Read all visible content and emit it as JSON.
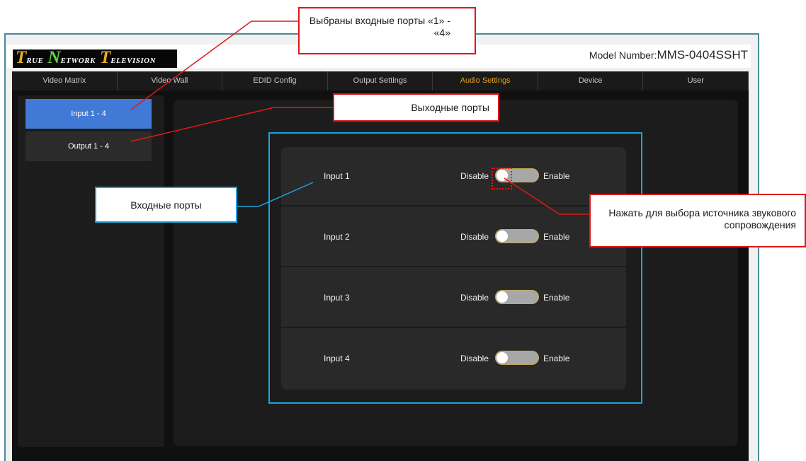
{
  "header": {
    "logo_parts": [
      "T",
      "RUE",
      "N",
      "ETWORK",
      "T",
      "ELEVISION"
    ],
    "model_label": "Model Number:",
    "model_value": "MMS-0404SSHT"
  },
  "nav": {
    "items": [
      {
        "label": "Video Matrix",
        "active": false
      },
      {
        "label": "Video Wall",
        "active": false
      },
      {
        "label": "EDID Config",
        "active": false
      },
      {
        "label": "Output Settings",
        "active": false
      },
      {
        "label": "Audio Settings",
        "active": true
      },
      {
        "label": "Device",
        "active": false
      },
      {
        "label": "User",
        "active": false
      }
    ]
  },
  "sidebar": {
    "items": [
      {
        "label": "Input 1 - 4",
        "active": true
      },
      {
        "label": "Output 1 - 4",
        "active": false
      }
    ]
  },
  "inputs": {
    "disable_label": "Disable",
    "enable_label": "Enable",
    "rows": [
      {
        "name": "Input 1",
        "enabled": false
      },
      {
        "name": "Input 2",
        "enabled": false
      },
      {
        "name": "Input 3",
        "enabled": false
      },
      {
        "name": "Input 4",
        "enabled": false
      }
    ]
  },
  "annotations": {
    "selected_inputs": "Выбраны входные порты «1» - «4»",
    "output_ports": "Выходные порты",
    "input_ports": "Входные порты",
    "click_hint": "Нажать для выбора источника звукового  сопровождения"
  },
  "colors": {
    "accent": "#e8a21a",
    "active_blue": "#4179d6",
    "callout_red": "#e01818",
    "callout_blue": "#19a3dd"
  }
}
